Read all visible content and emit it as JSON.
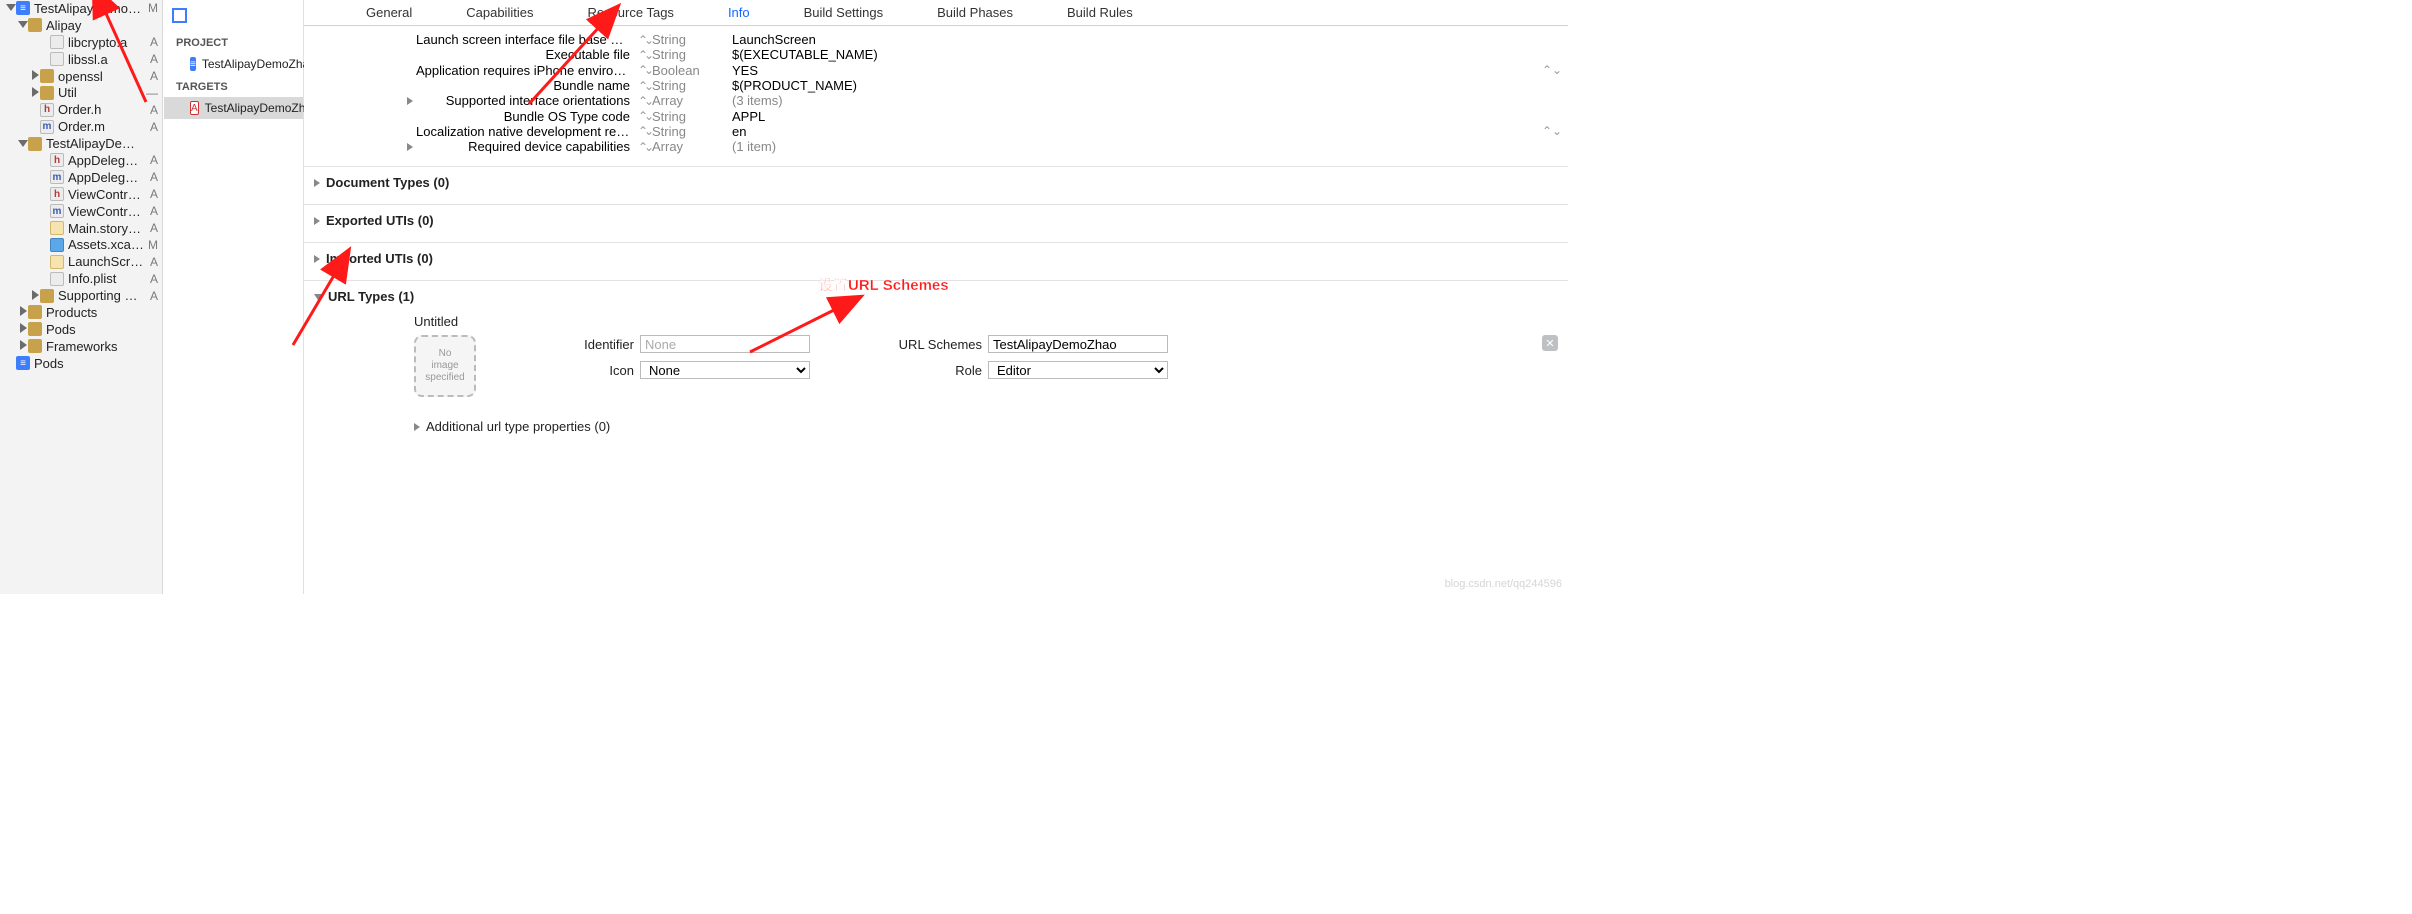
{
  "sidebar": {
    "items": [
      {
        "indent": 6,
        "disc": "down",
        "icon": "proj",
        "iconTxt": "≡",
        "label": "TestAlipayDemoZhao",
        "badge": "M"
      },
      {
        "indent": 18,
        "disc": "down",
        "icon": "folder",
        "iconTxt": "",
        "label": "Alipay",
        "badge": ""
      },
      {
        "indent": 40,
        "disc": "",
        "icon": "file",
        "iconTxt": "",
        "label": "libcrypto.a",
        "badge": "A"
      },
      {
        "indent": 40,
        "disc": "",
        "icon": "file",
        "iconTxt": "",
        "label": "libssl.a",
        "badge": "A"
      },
      {
        "indent": 30,
        "disc": "right",
        "icon": "folder",
        "iconTxt": "",
        "label": "openssl",
        "badge": "A"
      },
      {
        "indent": 30,
        "disc": "right",
        "icon": "folder",
        "iconTxt": "",
        "label": "Util",
        "badge": "—"
      },
      {
        "indent": 30,
        "disc": "",
        "icon": "h",
        "iconTxt": "h",
        "label": "Order.h",
        "badge": "A"
      },
      {
        "indent": 30,
        "disc": "",
        "icon": "m",
        "iconTxt": "m",
        "label": "Order.m",
        "badge": "A"
      },
      {
        "indent": 18,
        "disc": "down",
        "icon": "folder",
        "iconTxt": "",
        "label": "TestAlipayDemoZhao",
        "badge": ""
      },
      {
        "indent": 40,
        "disc": "",
        "icon": "h",
        "iconTxt": "h",
        "label": "AppDelegate.h",
        "badge": "A"
      },
      {
        "indent": 40,
        "disc": "",
        "icon": "m",
        "iconTxt": "m",
        "label": "AppDelegate.m",
        "badge": "A"
      },
      {
        "indent": 40,
        "disc": "",
        "icon": "h",
        "iconTxt": "h",
        "label": "ViewController.h",
        "badge": "A"
      },
      {
        "indent": 40,
        "disc": "",
        "icon": "m",
        "iconTxt": "m",
        "label": "ViewController.m",
        "badge": "A"
      },
      {
        "indent": 40,
        "disc": "",
        "icon": "sb",
        "iconTxt": "",
        "label": "Main.storyboard",
        "badge": "A"
      },
      {
        "indent": 40,
        "disc": "",
        "icon": "xc",
        "iconTxt": "",
        "label": "Assets.xcassets",
        "badge": "M"
      },
      {
        "indent": 40,
        "disc": "",
        "icon": "sb",
        "iconTxt": "",
        "label": "LaunchScr…toryboard",
        "badge": "A"
      },
      {
        "indent": 40,
        "disc": "",
        "icon": "pl",
        "iconTxt": "",
        "label": "Info.plist",
        "badge": "A"
      },
      {
        "indent": 30,
        "disc": "right",
        "icon": "folder",
        "iconTxt": "",
        "label": "Supporting Files",
        "badge": "A"
      },
      {
        "indent": 18,
        "disc": "right",
        "icon": "folder",
        "iconTxt": "",
        "label": "Products",
        "badge": ""
      },
      {
        "indent": 18,
        "disc": "right",
        "icon": "folder",
        "iconTxt": "",
        "label": "Pods",
        "badge": ""
      },
      {
        "indent": 18,
        "disc": "right",
        "icon": "folder",
        "iconTxt": "",
        "label": "Frameworks",
        "badge": ""
      },
      {
        "indent": 6,
        "disc": "",
        "icon": "proj",
        "iconTxt": "≡",
        "label": "Pods",
        "badge": ""
      }
    ]
  },
  "projcol": {
    "projectHdr": "PROJECT",
    "projectItem": "TestAlipayDemoZhao",
    "targetsHdr": "TARGETS",
    "targetItem": "TestAlipayDemoZhao"
  },
  "tabs": [
    "General",
    "Capabilities",
    "Resource Tags",
    "Info",
    "Build Settings",
    "Build Phases",
    "Build Rules"
  ],
  "activeTab": 3,
  "props": [
    {
      "disc": "",
      "key": "Launch screen interface file base name",
      "type": "String",
      "val": "LaunchScreen",
      "stepR": false
    },
    {
      "disc": "",
      "key": "Executable file",
      "type": "String",
      "val": "$(EXECUTABLE_NAME)",
      "stepR": false
    },
    {
      "disc": "",
      "key": "Application requires iPhone environm…",
      "type": "Boolean",
      "val": "YES",
      "stepR": true
    },
    {
      "disc": "",
      "key": "Bundle name",
      "type": "String",
      "val": "$(PRODUCT_NAME)",
      "stepR": false
    },
    {
      "disc": "right",
      "key": "Supported interface orientations",
      "type": "Array",
      "val": "(3 items)",
      "stepR": false
    },
    {
      "disc": "",
      "key": "Bundle OS Type code",
      "type": "String",
      "val": "APPL",
      "stepR": false
    },
    {
      "disc": "",
      "key": "Localization native development region",
      "type": "String",
      "val": "en",
      "stepR": true
    },
    {
      "disc": "right",
      "key": "Required device capabilities",
      "type": "Array",
      "val": "(1 item)",
      "stepR": false
    }
  ],
  "sections": {
    "doc": "Document Types (0)",
    "exp": "Exported UTIs (0)",
    "imp": "Imported UTIs (0)",
    "url": "URL Types (1)"
  },
  "urlType": {
    "title": "Untitled",
    "noimg1": "No",
    "noimg2": "image",
    "noimg3": "specified",
    "identLabel": "Identifier",
    "identPh": "None",
    "iconLabel": "Icon",
    "iconVal": "None",
    "schemesLabel": "URL Schemes",
    "schemesVal": "TestAlipayDemoZhao",
    "roleLabel": "Role",
    "roleVal": "Editor",
    "additional": "Additional url type properties (0)"
  },
  "annotation": "设置URL Schemes",
  "watermark": "blog.csdn.net/qq244596"
}
